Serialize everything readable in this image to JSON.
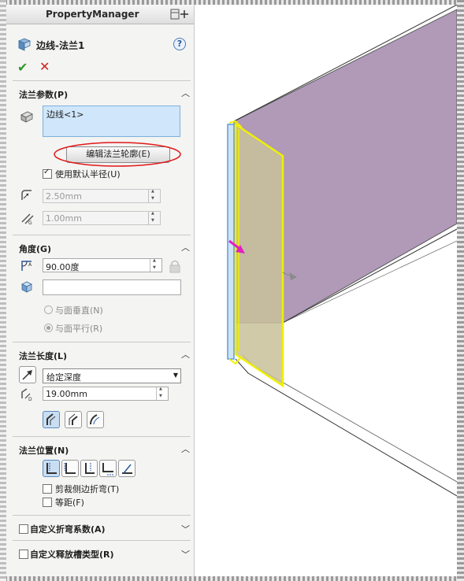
{
  "header": {
    "title": "PropertyManager"
  },
  "feature": {
    "title": "边线-法兰1",
    "help": "?"
  },
  "actions": {
    "ok": "✔",
    "cancel": "✕"
  },
  "flange_params": {
    "title": "法兰参数(P)",
    "edge_item": "边线<1>",
    "edit_profile_button": "编辑法兰轮廓(E)",
    "use_default_radius_label": "使用默认半径(U)",
    "use_default_radius_checked": true,
    "radius_value": "2.50mm",
    "gap_value": "1.00mm"
  },
  "angle": {
    "title": "角度(G)",
    "value": "90.00度",
    "face_input": "",
    "radio_perpendicular": "与面垂直(N)",
    "radio_parallel": "与面平行(R)"
  },
  "flange_length": {
    "title": "法兰长度(L)",
    "end_condition": "给定深度",
    "length_value": "19.00mm"
  },
  "flange_position": {
    "title": "法兰位置(N)",
    "trim_side_bends_label": "剪裁侧边折弯(T)",
    "trim_side_bends_checked": false,
    "offset_label": "等距(F)",
    "offset_checked": false
  },
  "custom_bend_allowance": {
    "label": "自定义折弯系数(A)",
    "checked": false
  },
  "custom_relief_type": {
    "label": "自定义释放槽类型(R)",
    "checked": false
  },
  "colors": {
    "purple_face": "#b09ab8",
    "flange_fill": "#c9c19a",
    "flange_outline": "#f0f000",
    "edge_blue": "#5a9be0",
    "arrow_magenta": "#e020c0",
    "annotation_red": "#e01818"
  }
}
